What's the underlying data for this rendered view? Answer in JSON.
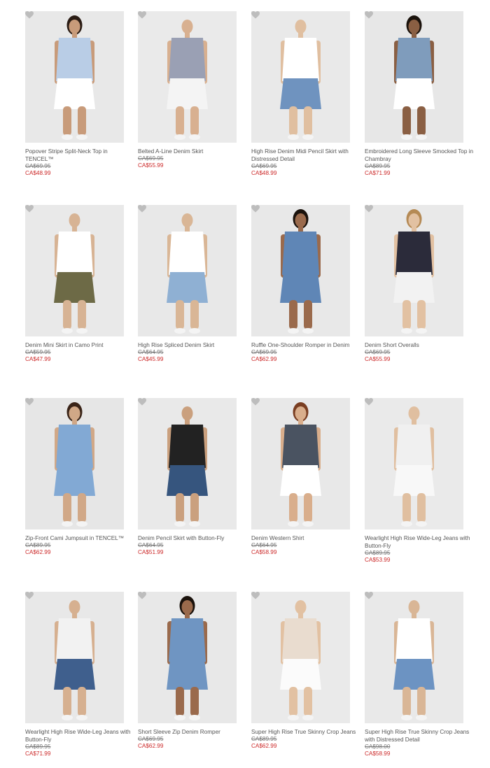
{
  "products": [
    {
      "name": "Popover Stripe Split-Neck Top in TENCEL™",
      "was": "CA$69.95",
      "now": "CA$48.99",
      "bg": "#e8e8e8",
      "top": "#b9cde6",
      "bottom": "#ffffff",
      "skin": "#c89b7a",
      "hair": "#2a1c14",
      "lines": 2
    },
    {
      "name": "Belted A-Line Denim Skirt",
      "was": "CA$69.95",
      "now": "CA$55.99",
      "bg": "#eaeaea",
      "top": "#9aa0b4",
      "bottom": "#f4f4f4",
      "skin": "#d8b090",
      "hair": "#eaeaea",
      "lines": 1
    },
    {
      "name": "High Rise Denim Midi Pencil Skirt with Distressed Detail",
      "was": "CA$69.95",
      "now": "CA$48.99",
      "bg": "#e9e9e9",
      "top": "#ffffff",
      "bottom": "#6f93bf",
      "skin": "#e0bfa0",
      "hair": "#e9e9e9",
      "lines": 2
    },
    {
      "name": "Embroidered Long Sleeve Smocked Top in Chambray",
      "was": "CA$89.95",
      "now": "CA$71.99",
      "bg": "#e7e7e7",
      "top": "#7f9cbc",
      "bottom": "#ffffff",
      "skin": "#8a5f43",
      "hair": "#1a120c",
      "lines": 2
    },
    {
      "name": "Denim Mini Skirt in Camo Print",
      "was": "CA$59.95",
      "now": "CA$47.99",
      "bg": "#e9e9e9",
      "top": "#ffffff",
      "bottom": "#6d6a46",
      "skin": "#d7b394",
      "hair": "#e9e9e9",
      "lines": 1
    },
    {
      "name": "High Rise Spliced Denim Skirt",
      "was": "CA$64.95",
      "now": "CA$45.99",
      "bg": "#e8e8e8",
      "top": "#ffffff",
      "bottom": "#8fb0d3",
      "skin": "#d9b696",
      "hair": "#e8e8e8",
      "lines": 1
    },
    {
      "name": "Ruffle One-Shoulder Romper in Denim",
      "was": "CA$69.95",
      "now": "CA$62.99",
      "bg": "#e8e8e8",
      "top": "#5f86b6",
      "bottom": "#5f86b6",
      "skin": "#9a6a4c",
      "hair": "#1a120c",
      "lines": 1
    },
    {
      "name": "Denim Short Overalls",
      "was": "CA$69.95",
      "now": "CA$55.99",
      "bg": "#e9e9e9",
      "top": "#2b2b3a",
      "bottom": "#f2f2f2",
      "skin": "#e2c1a2",
      "hair": "#b58a55",
      "lines": 1
    },
    {
      "name": "Zip-Front Cami Jumpsuit in TENCEL™",
      "was": "CA$89.95",
      "now": "CA$62.99",
      "bg": "#e6e6e6",
      "top": "#82a9d4",
      "bottom": "#82a9d4",
      "skin": "#d1a887",
      "hair": "#3a2418",
      "lines": 1
    },
    {
      "name": "Denim Pencil Skirt with Button-Fly",
      "was": "CA$64.95",
      "now": "CA$51.99",
      "bg": "#e9e9e9",
      "top": "#222222",
      "bottom": "#36557e",
      "skin": "#caa07e",
      "hair": "#e9e9e9",
      "lines": 1
    },
    {
      "name": "Denim Western Shirt",
      "was": "CA$64.95",
      "now": "CA$58.99",
      "bg": "#e8e8e8",
      "top": "#4a5361",
      "bottom": "#ffffff",
      "skin": "#d9ae8c",
      "hair": "#7a3e22",
      "lines": 1
    },
    {
      "name": "Wearlight High Rise Wide-Leg Jeans with Button-Fly",
      "was": "CA$89.95",
      "now": "CA$53.99",
      "bg": "#eaeaea",
      "top": "#f0f0f0",
      "bottom": "#f8f8f8",
      "skin": "#e0bfa0",
      "hair": "#eaeaea",
      "lines": 2
    },
    {
      "name": "Wearlight High Rise Wide-Leg Jeans with Button-Fly",
      "was": "CA$89.95",
      "now": "CA$71.99",
      "bg": "#e8e8e8",
      "top": "#f2f2f2",
      "bottom": "#3f5f8d",
      "skin": "#d6b090",
      "hair": "#e8e8e8",
      "lines": 2
    },
    {
      "name": "Short Sleeve Zip Denim Romper",
      "was": "CA$69.95",
      "now": "CA$62.99",
      "bg": "#e8e8e8",
      "top": "#6f95c2",
      "bottom": "#6f95c2",
      "skin": "#9a6a4c",
      "hair": "#1a120c",
      "lines": 1
    },
    {
      "name": "Super High Rise True Skinny Crop Jeans",
      "was": "CA$89.95",
      "now": "CA$62.99",
      "bg": "#eaeaea",
      "top": "#e9dccf",
      "bottom": "#fbfbfb",
      "skin": "#e2c1a2",
      "hair": "#eaeaea",
      "lines": 1
    },
    {
      "name": "Super High Rise True Skinny Crop Jeans with Distressed Detail",
      "was": "CA$98.00",
      "now": "CA$58.99",
      "bg": "#e9e9e9",
      "top": "#ffffff",
      "bottom": "#6c93c2",
      "skin": "#d9b696",
      "hair": "#e9e9e9",
      "lines": 2
    }
  ]
}
